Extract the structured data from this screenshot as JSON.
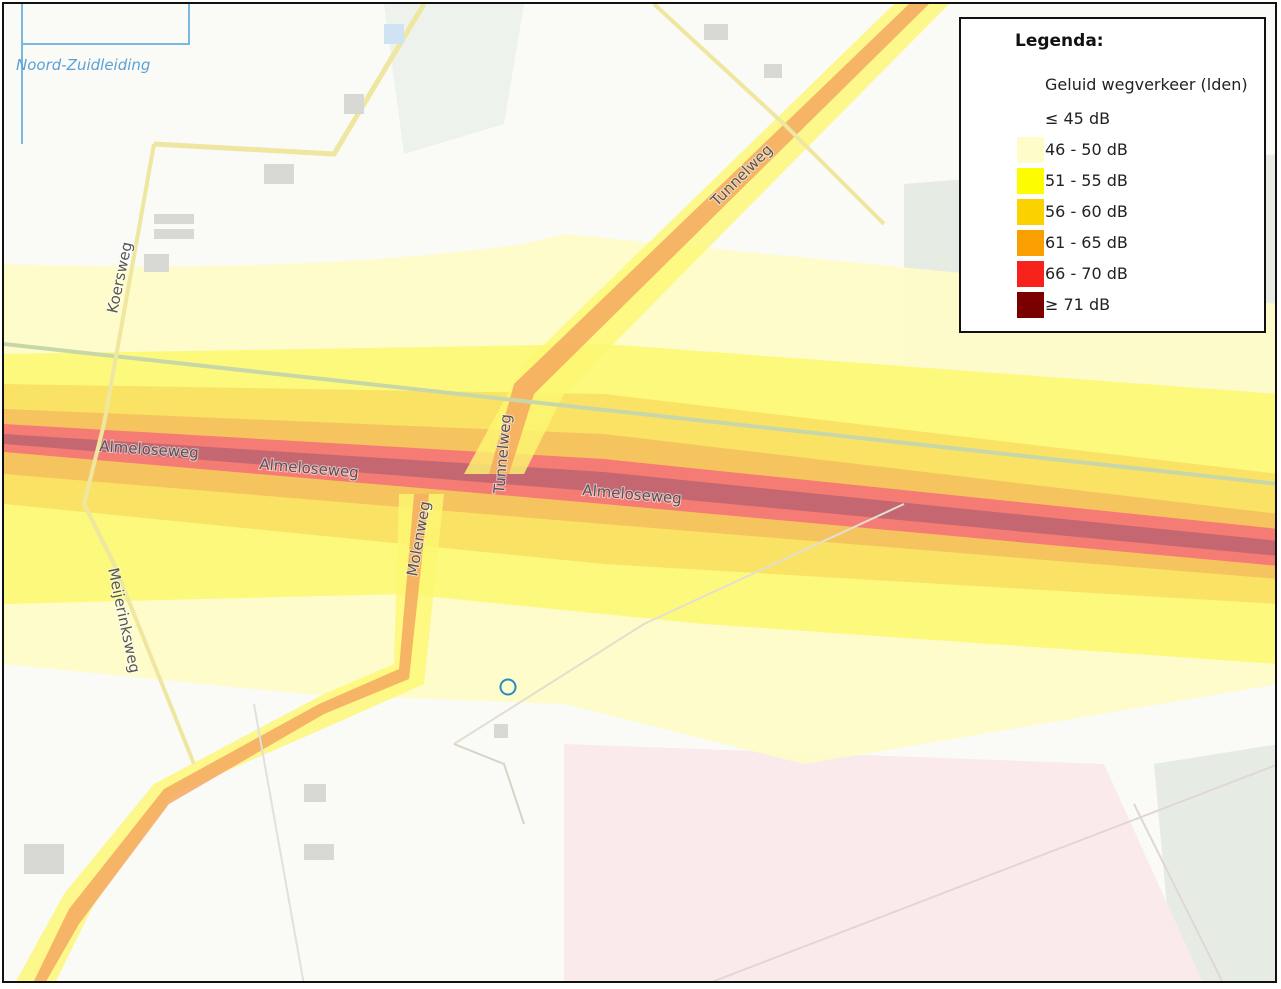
{
  "map": {
    "water_label": "Noord-Zuidleiding",
    "road_labels": {
      "almelo_1": "Almeloseweg",
      "almelo_2": "Almeloseweg",
      "almelo_3": "Almeloseweg",
      "tunnel_1": "Tunnelweg",
      "tunnel_2": "Tunnelweg",
      "molen": "Molenweg",
      "koers": "Koersweg",
      "meijerinks": "Meijerinksweg"
    },
    "noise_colors": {
      "le45": "#ffffff",
      "c46_50": "#fefcc8",
      "c51_55": "#fefc00",
      "c56_60": "#fcd100",
      "c61_65": "#f9a000",
      "c66_70": "#f8221d",
      "ge71": "#7a0000"
    }
  },
  "legend": {
    "title": "Legenda:",
    "subtitle": "Geluid wegverkeer (lden)",
    "items": [
      {
        "label": "≤ 45 dB",
        "color": "#ffffff"
      },
      {
        "label": "46 - 50 dB",
        "color": "#fefcc8"
      },
      {
        "label": "51 - 55 dB",
        "color": "#fefc00"
      },
      {
        "label": "56 - 60 dB",
        "color": "#fcd100"
      },
      {
        "label": "61 - 65 dB",
        "color": "#f9a000"
      },
      {
        "label": "66 - 70 dB",
        "color": "#f8221d"
      },
      {
        "label": "≥ 71 dB",
        "color": "#7a0000"
      }
    ]
  }
}
